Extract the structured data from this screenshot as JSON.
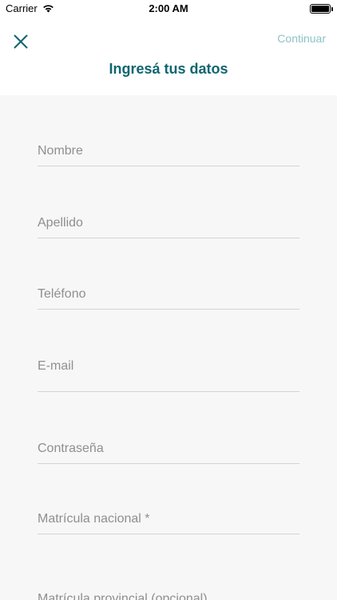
{
  "status_bar": {
    "carrier": "Carrier",
    "time": "2:00 AM",
    "wifi_icon": "wifi-icon",
    "battery_icon": "battery-icon"
  },
  "header": {
    "close_icon": "close-icon",
    "continue_label": "Continuar",
    "title": "Ingresá tus datos"
  },
  "form": {
    "fields": [
      {
        "placeholder": "Nombre"
      },
      {
        "placeholder": "Apellido"
      },
      {
        "placeholder": "Teléfono"
      },
      {
        "placeholder": "E-mail"
      },
      {
        "placeholder": "Contraseña"
      },
      {
        "placeholder": "Matrícula nacional *"
      },
      {
        "placeholder": "Matrícula provincial (opcional)"
      }
    ]
  },
  "colors": {
    "accent": "#0f6570",
    "continue_disabled": "#8fc3c6",
    "placeholder": "#8f8f8f",
    "background": "#f7f7f7"
  }
}
